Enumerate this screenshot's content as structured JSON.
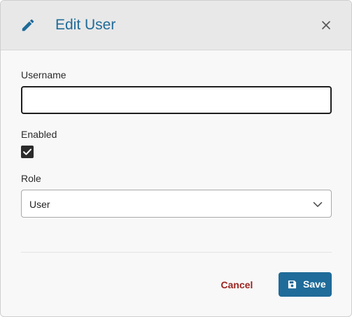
{
  "dialog": {
    "title": "Edit User",
    "title_icon": "pencil-icon",
    "close_icon": "close-icon",
    "accent_color": "#1f6b99"
  },
  "form": {
    "username": {
      "label": "Username",
      "value": "",
      "placeholder": ""
    },
    "enabled": {
      "label": "Enabled",
      "checked": true
    },
    "role": {
      "label": "Role",
      "selected": "User",
      "icon": "chevron-down-icon"
    }
  },
  "actions": {
    "cancel_label": "Cancel",
    "cancel_color": "#9b2420",
    "save_label": "Save",
    "save_icon": "floppy-disk-icon"
  }
}
